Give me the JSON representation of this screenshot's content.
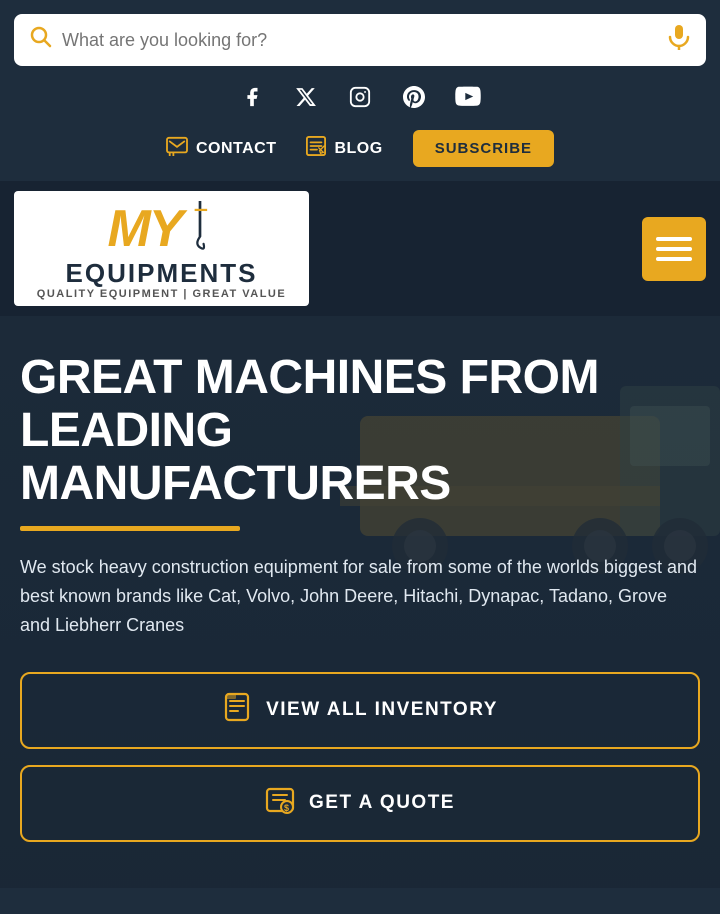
{
  "search": {
    "placeholder": "What are you looking for?"
  },
  "social": {
    "icons": [
      {
        "name": "facebook",
        "symbol": "f"
      },
      {
        "name": "twitter-x",
        "symbol": "𝕏"
      },
      {
        "name": "instagram",
        "symbol": "◉"
      },
      {
        "name": "pinterest",
        "symbol": "𝑝"
      },
      {
        "name": "youtube",
        "symbol": "▶"
      }
    ]
  },
  "nav": {
    "contact_label": "CONTACT",
    "blog_label": "BLOG",
    "subscribe_label": "SUBSCRIBE"
  },
  "logo": {
    "brand": "MY",
    "name": "EQUIPMENTS",
    "tagline": "QUALITY EQUIPMENT | GREAT VALUE"
  },
  "hero": {
    "title_line1": "GREAT MACHINES FROM",
    "title_line2": "LEADING",
    "title_line3": "MANUFACTURERS",
    "description": "We stock heavy construction equipment for sale from some of the worlds biggest and best known brands like Cat, Volvo, John Deere, Hitachi, Dynapac, Tadano, Grove and Liebherr Cranes",
    "cta_inventory": "VIEW ALL INVENTORY",
    "cta_quote": "GET A QUOTE"
  }
}
